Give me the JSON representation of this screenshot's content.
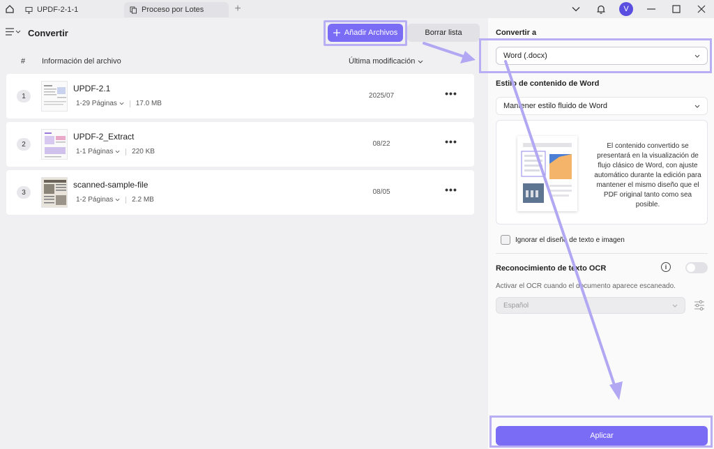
{
  "titlebar": {
    "home_icon": "home-icon",
    "tabs": [
      {
        "label": "UPDF-2-1-1",
        "icon": "monitor-icon"
      },
      {
        "label": "Proceso por Lotes",
        "icon": "copy-icon"
      }
    ],
    "new_tab": "+",
    "avatar_letter": "V"
  },
  "left": {
    "title": "Convertir",
    "add_label": "Añadir Archivos",
    "clear_label": "Borrar lista",
    "columns": {
      "hash": "#",
      "info": "Información del archivo",
      "date": "Última modificación"
    },
    "files": [
      {
        "index": "1",
        "name": "UPDF-2.1",
        "pages": "1-29 Páginas",
        "size": "17.0 MB",
        "date": "2025/07"
      },
      {
        "index": "2",
        "name": "UPDF-2_Extract",
        "pages": "1-1 Páginas",
        "size": "220 KB",
        "date": "08/22"
      },
      {
        "index": "3",
        "name": "scanned-sample-file",
        "pages": "1-2 Páginas",
        "size": "2.2 MB",
        "date": "08/05"
      }
    ],
    "more_label": "•••"
  },
  "right": {
    "convert_to_label": "Convertir a",
    "convert_to_value": "Word (.docx)",
    "style_label": "Estilo de contenido de Word",
    "style_value": "Mantener estilo fluido de Word",
    "preview_desc": "El contenido convertido se presentará en la visualización de flujo clásico de Word, con ajuste automático durante la edición para mantener el mismo diseño que el PDF original tanto como sea posible.",
    "ignore_layout_label": "Ignorar el diseño de texto e imagen",
    "ocr_label": "Reconocimiento de texto OCR",
    "ocr_desc": "Activar el OCR cuando el documento aparece escaneado.",
    "ocr_language": "Español",
    "apply_label": "Aplicar"
  },
  "colors": {
    "accent": "#7b6cf6",
    "highlight": "#b7aef3",
    "avatar": "#5a4ee0"
  }
}
